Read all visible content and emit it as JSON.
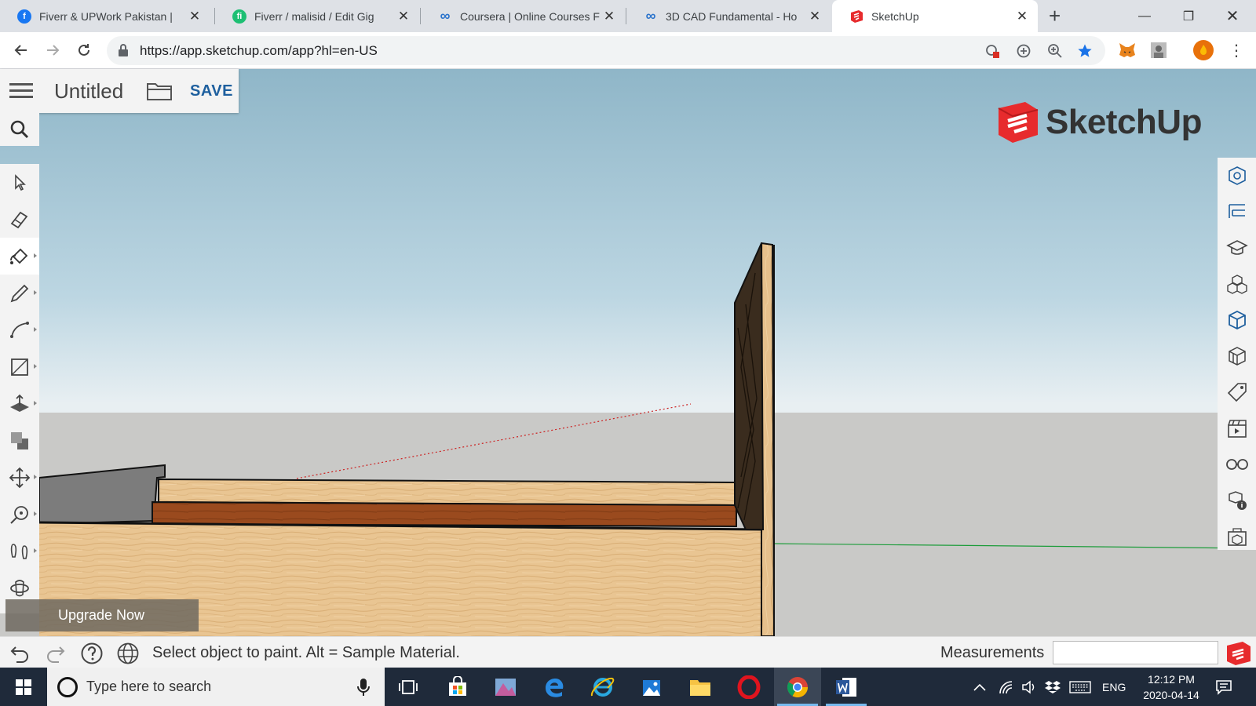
{
  "browser": {
    "tabs": [
      {
        "title": "Fiverr & UPWork Pakistan |",
        "favicon": "facebook-icon",
        "color": "#1877f2",
        "glyph": "f"
      },
      {
        "title": "Fiverr / malisid / Edit Gig",
        "favicon": "fiverr-icon",
        "color": "#1dbf73",
        "glyph": "fi"
      },
      {
        "title": "Coursera | Online Courses F",
        "favicon": "coursera-icon",
        "color": "#2a73cc",
        "glyph": "∞"
      },
      {
        "title": "3D CAD Fundamental - Ho",
        "favicon": "coursera-icon",
        "color": "#2a73cc",
        "glyph": "∞"
      },
      {
        "title": "SketchUp",
        "favicon": "sketchup-icon",
        "color": "#e72b2d",
        "glyph": ""
      }
    ],
    "url": "https://app.sketchup.com/app?hl=en-US"
  },
  "app": {
    "doc_title": "Untitled",
    "save_label": "SAVE",
    "logo_text": "SketchUp",
    "upgrade_label": "Upgrade Now",
    "status_text": "Select object to paint. Alt = Sample Material.",
    "measurements_label": "Measurements",
    "measurements_value": "",
    "brand_color": "#e72b2d",
    "left_tools": [
      "select-tool",
      "eraser-tool",
      "paint-bucket-tool",
      "pencil-tool",
      "arc-tool",
      "rectangle-tool",
      "push-pull-tool",
      "offset-tool",
      "move-tool",
      "tape-measure-tool",
      "walk-tool",
      "orbit-tool"
    ],
    "active_tool": "paint-bucket-tool",
    "right_panels": [
      "entity-info-panel",
      "outliner-panel",
      "instructor-panel",
      "components-panel",
      "materials-panel",
      "styles-panel",
      "tags-panel",
      "scenes-panel",
      "display-panel",
      "model-info-panel",
      "solid-inspector-panel"
    ]
  },
  "taskbar": {
    "search_placeholder": "Type here to search",
    "language": "ENG",
    "time": "12:12 PM",
    "date": "2020-04-14"
  }
}
